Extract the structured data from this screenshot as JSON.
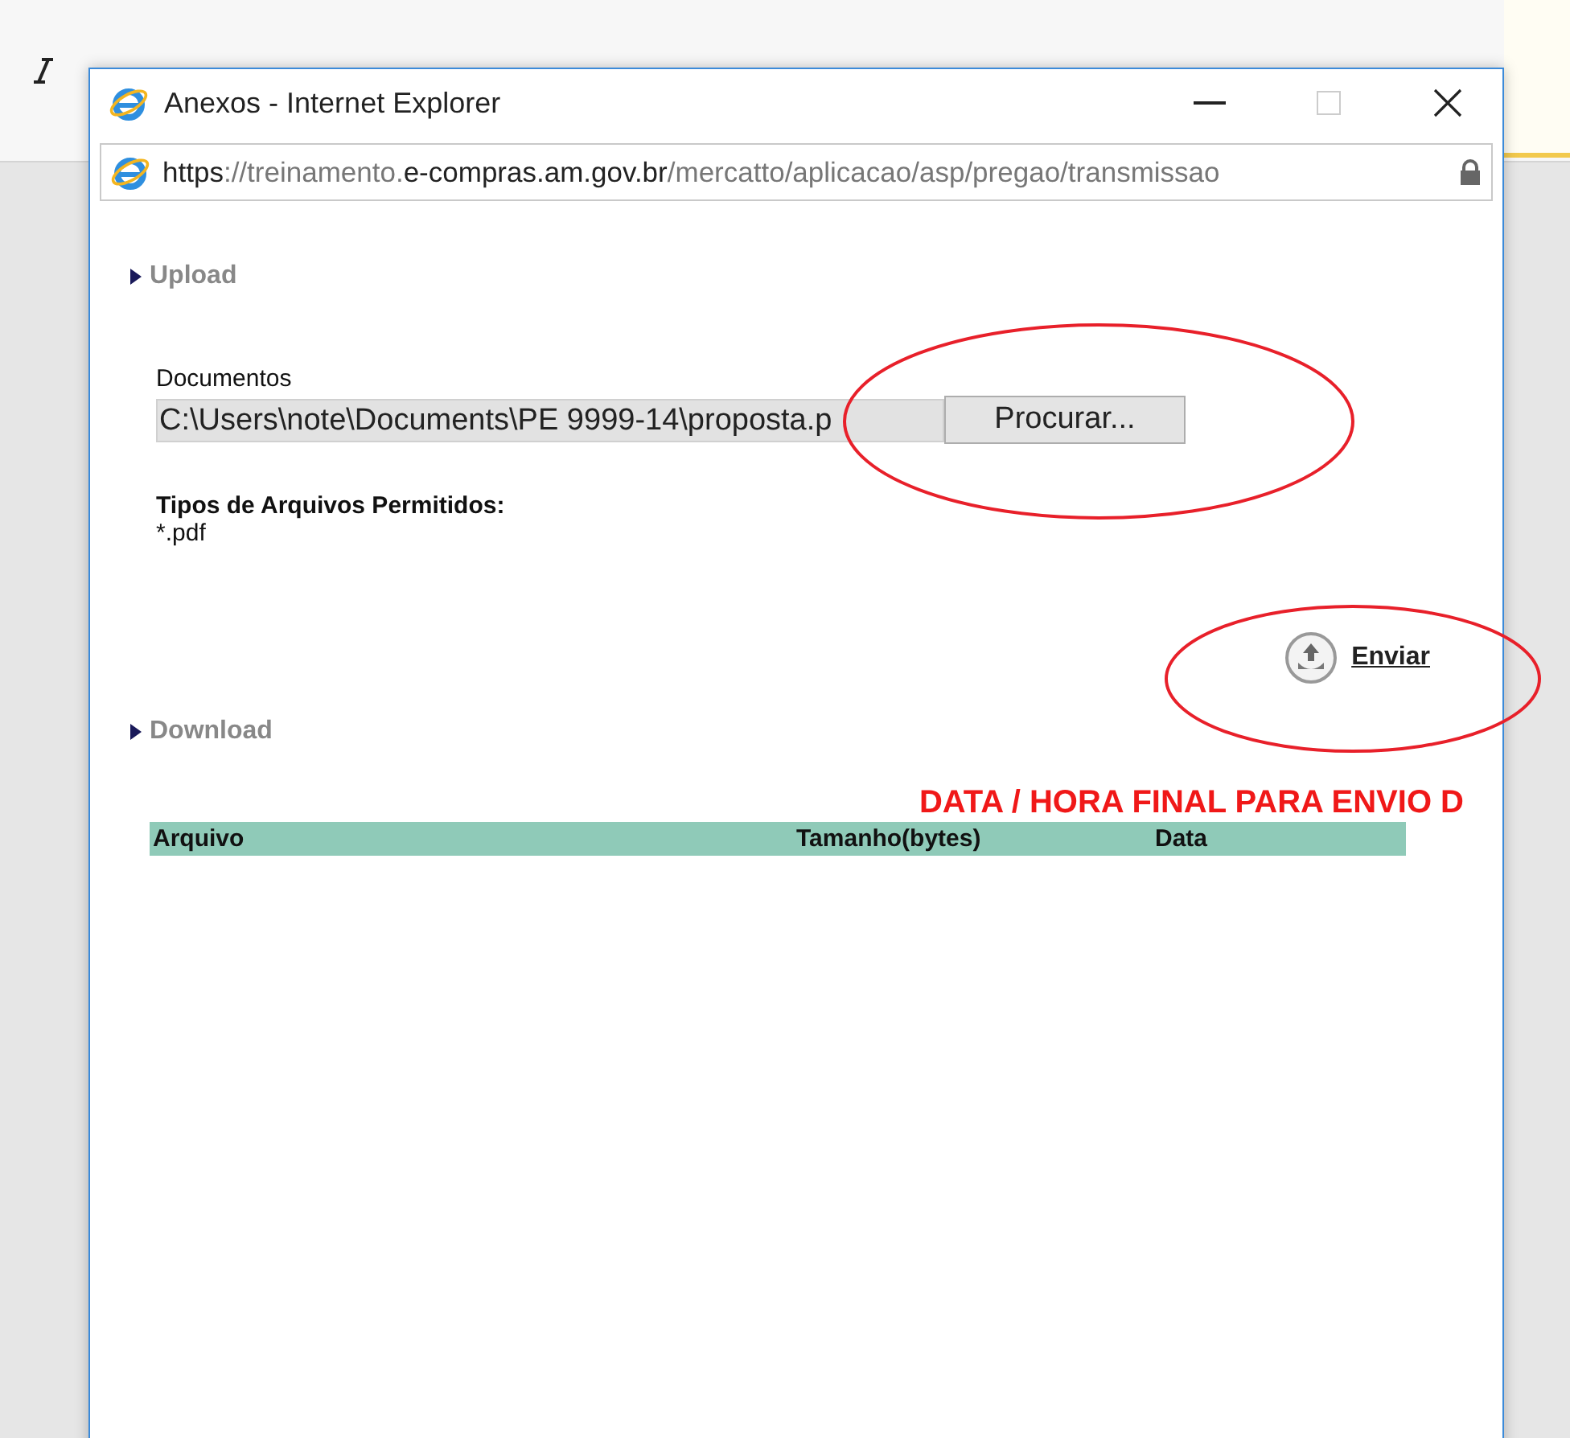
{
  "window": {
    "title": "Anexos - Internet Explorer",
    "url": {
      "scheme": "https",
      "host_prefix": "://treinamento.",
      "host": "e-compras.am.gov.br",
      "path": "/mercatto/aplicacao/asp/pregao/transmissao"
    }
  },
  "upload": {
    "heading": "Upload",
    "field_label": "Documentos",
    "file_value": "C:\\Users\\note\\Documents\\PE 9999-14\\proposta.p",
    "browse_button": "Procurar...",
    "allowed_label": "Tipos de Arquivos Permitidos:",
    "allowed_types": "*.pdf",
    "send_link": "Enviar"
  },
  "download": {
    "heading": "Download",
    "deadline_notice": "DATA / HORA FINAL PARA ENVIO D",
    "table": {
      "columns": [
        "Arquivo",
        "Tamanho(bytes)",
        "Data"
      ]
    }
  },
  "annotations": [
    {
      "kind": "ellipse"
    },
    {
      "kind": "ellipse"
    }
  ]
}
